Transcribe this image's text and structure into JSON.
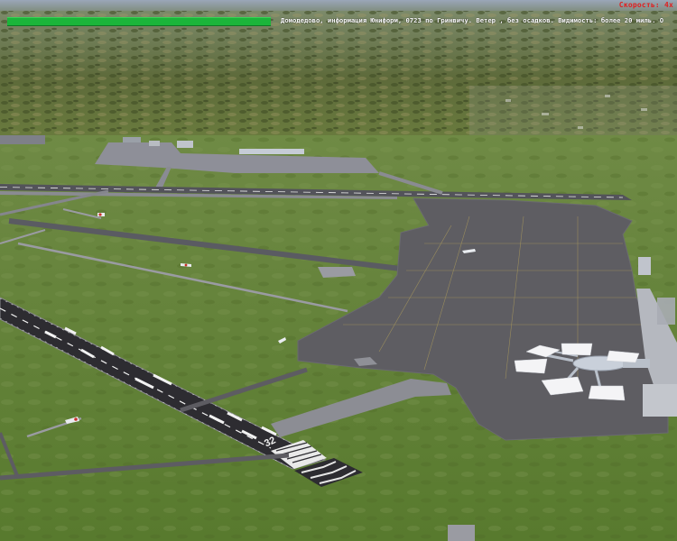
{
  "hud": {
    "speed_text": "Скорость: 4x",
    "atis_text": "Домодедово, информация Юниформ, 0723 по Гринвичу. Ветер , без осадков. Видимость:  более 20 миль. О"
  },
  "runway": {
    "marking": "32"
  },
  "colors": {
    "atis_bar": "#1bb53a",
    "speed_text": "#e02020",
    "grass": "#6b8a3f",
    "asphalt": "#5e5d62"
  }
}
